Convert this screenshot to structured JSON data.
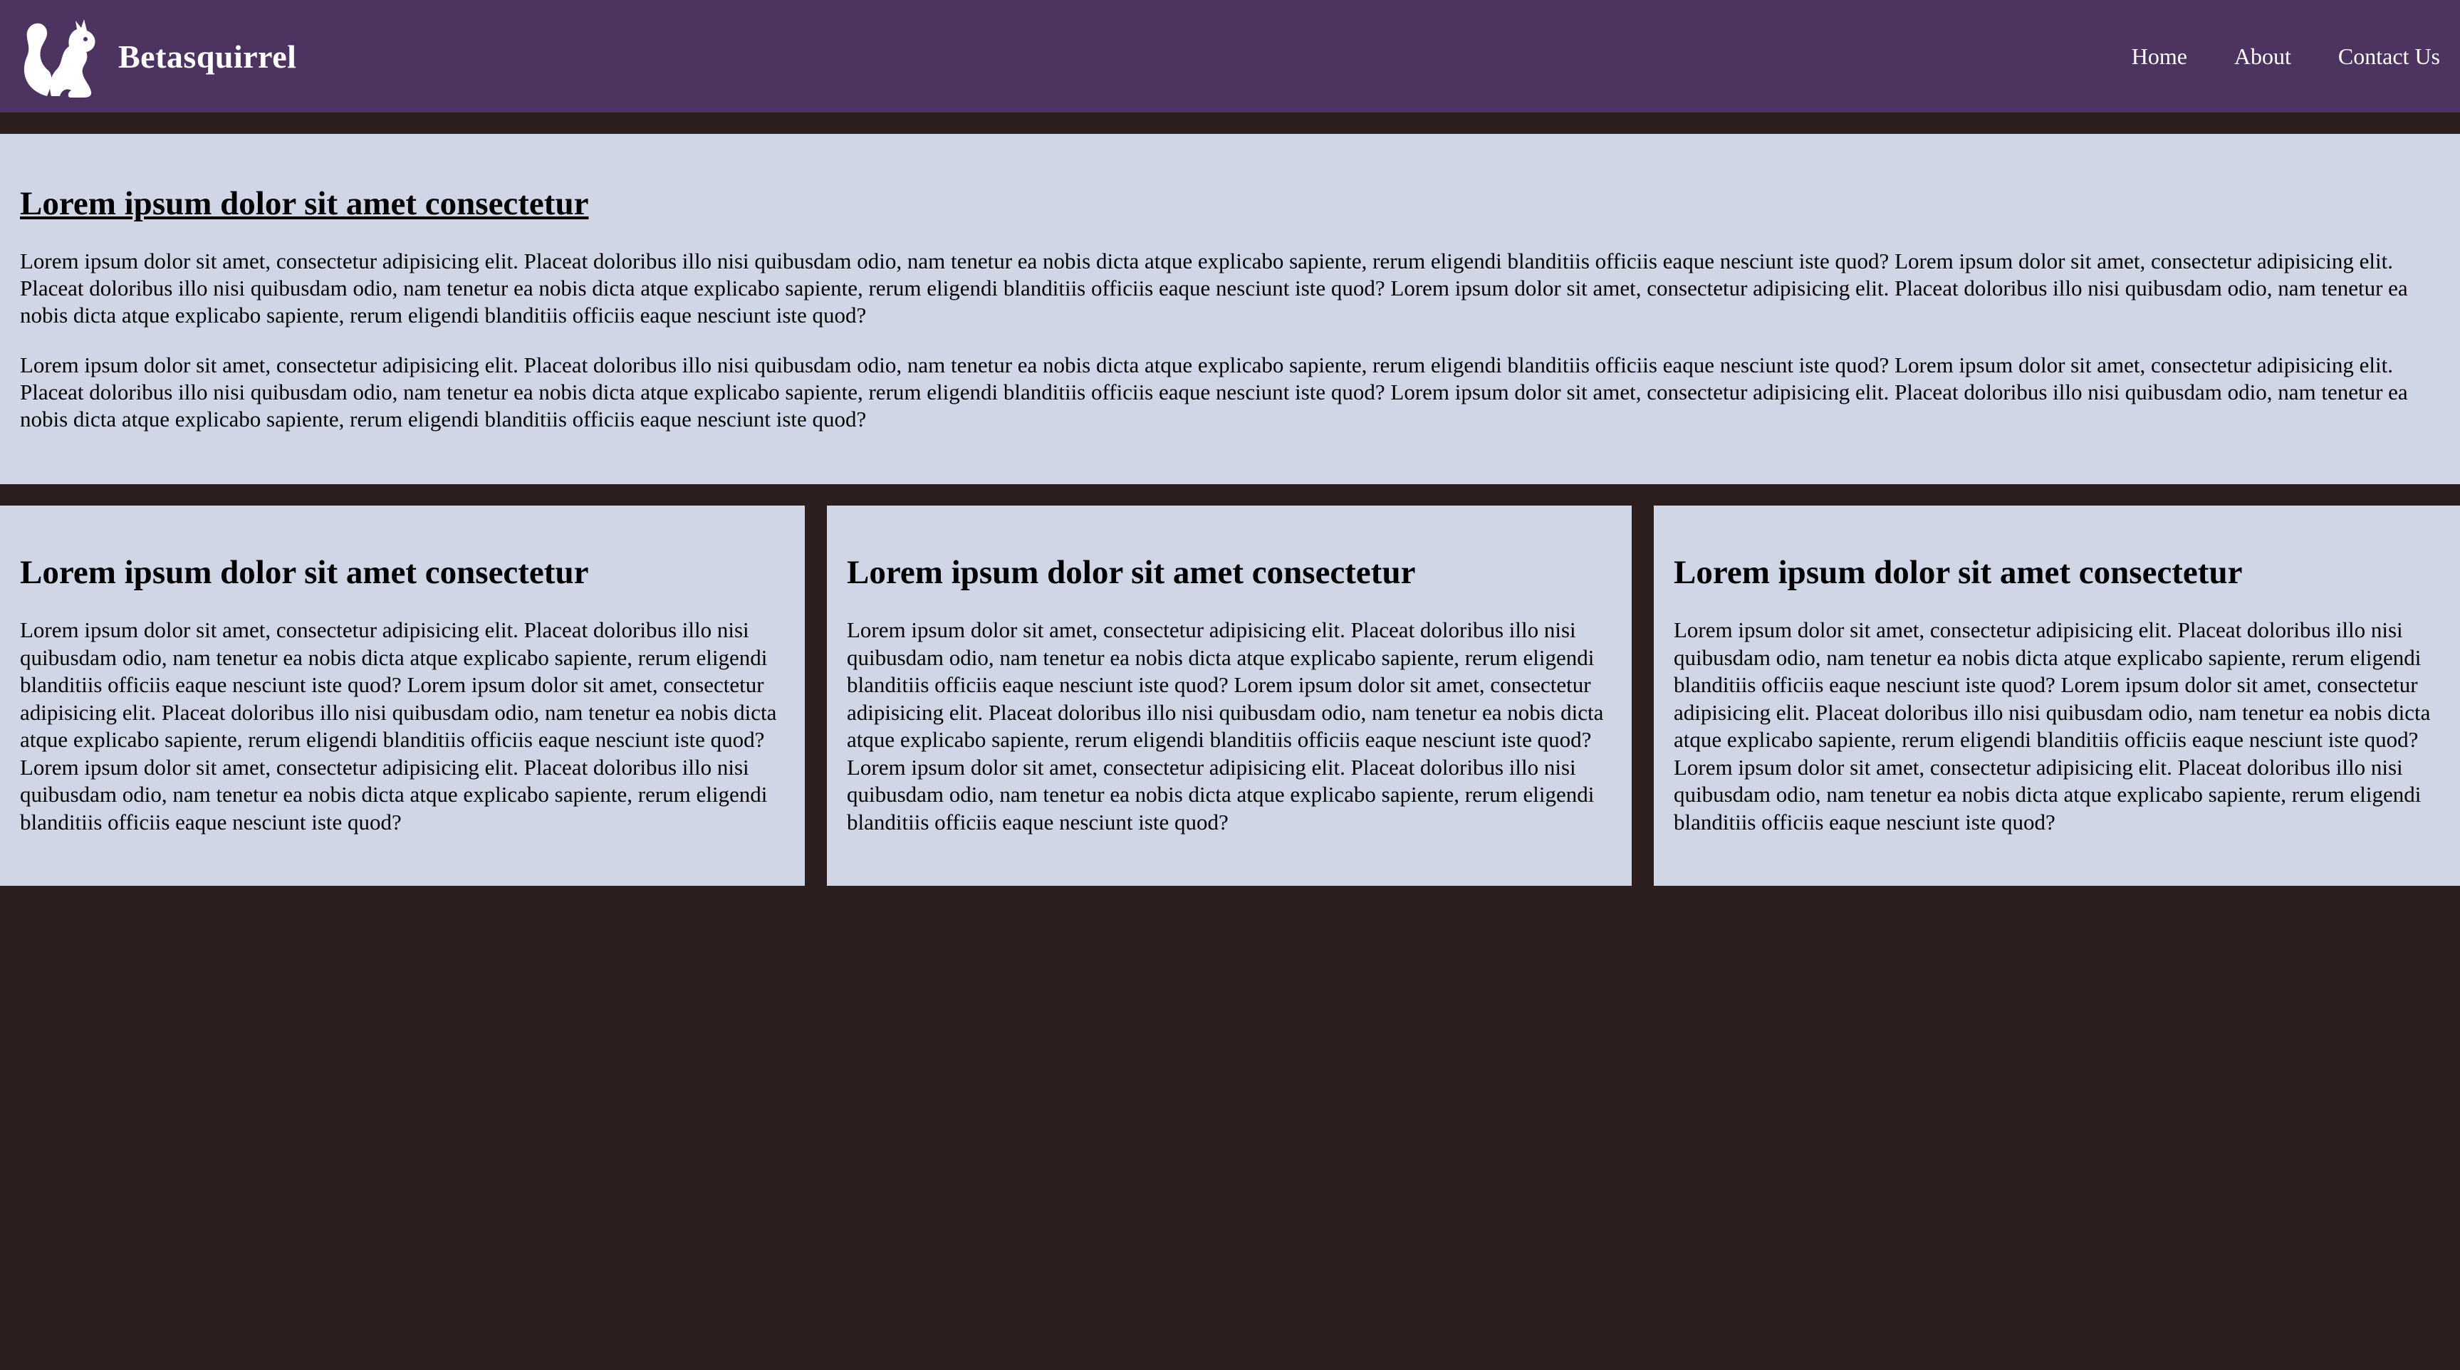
{
  "header": {
    "brand_name": "Betasquirrel",
    "logo_icon": "squirrel-icon",
    "nav": [
      {
        "label": "Home"
      },
      {
        "label": "About"
      },
      {
        "label": "Contact Us"
      }
    ]
  },
  "hero": {
    "title": "Lorem ipsum dolor sit amet consectetur",
    "paragraphs": [
      "Lorem ipsum dolor sit amet, consectetur adipisicing elit. Placeat doloribus illo nisi quibusdam odio, nam tenetur ea nobis dicta atque explicabo sapiente, rerum eligendi blanditiis officiis eaque nesciunt iste quod? Lorem ipsum dolor sit amet, consectetur adipisicing elit. Placeat doloribus illo nisi quibusdam odio, nam tenetur ea nobis dicta atque explicabo sapiente, rerum eligendi blanditiis officiis eaque nesciunt iste quod? Lorem ipsum dolor sit amet, consectetur adipisicing elit. Placeat doloribus illo nisi quibusdam odio, nam tenetur ea nobis dicta atque explicabo sapiente, rerum eligendi blanditiis officiis eaque nesciunt iste quod?",
      "Lorem ipsum dolor sit amet, consectetur adipisicing elit. Placeat doloribus illo nisi quibusdam odio, nam tenetur ea nobis dicta atque explicabo sapiente, rerum eligendi blanditiis officiis eaque nesciunt iste quod? Lorem ipsum dolor sit amet, consectetur adipisicing elit. Placeat doloribus illo nisi quibusdam odio, nam tenetur ea nobis dicta atque explicabo sapiente, rerum eligendi blanditiis officiis eaque nesciunt iste quod? Lorem ipsum dolor sit amet, consectetur adipisicing elit. Placeat doloribus illo nisi quibusdam odio, nam tenetur ea nobis dicta atque explicabo sapiente, rerum eligendi blanditiis officiis eaque nesciunt iste quod?"
    ]
  },
  "cards": [
    {
      "title": "Lorem ipsum dolor sit amet consectetur",
      "body": "Lorem ipsum dolor sit amet, consectetur adipisicing elit. Placeat doloribus illo nisi quibusdam odio, nam tenetur ea nobis dicta atque explicabo sapiente, rerum eligendi blanditiis officiis eaque nesciunt iste quod? Lorem ipsum dolor sit amet, consectetur adipisicing elit. Placeat doloribus illo nisi quibusdam odio, nam tenetur ea nobis dicta atque explicabo sapiente, rerum eligendi blanditiis officiis eaque nesciunt iste quod? Lorem ipsum dolor sit amet, consectetur adipisicing elit. Placeat doloribus illo nisi quibusdam odio, nam tenetur ea nobis dicta atque explicabo sapiente, rerum eligendi blanditiis officiis eaque nesciunt iste quod?"
    },
    {
      "title": "Lorem ipsum dolor sit amet consectetur",
      "body": "Lorem ipsum dolor sit amet, consectetur adipisicing elit. Placeat doloribus illo nisi quibusdam odio, nam tenetur ea nobis dicta atque explicabo sapiente, rerum eligendi blanditiis officiis eaque nesciunt iste quod? Lorem ipsum dolor sit amet, consectetur adipisicing elit. Placeat doloribus illo nisi quibusdam odio, nam tenetur ea nobis dicta atque explicabo sapiente, rerum eligendi blanditiis officiis eaque nesciunt iste quod? Lorem ipsum dolor sit amet, consectetur adipisicing elit. Placeat doloribus illo nisi quibusdam odio, nam tenetur ea nobis dicta atque explicabo sapiente, rerum eligendi blanditiis officiis eaque nesciunt iste quod?"
    },
    {
      "title": "Lorem ipsum dolor sit amet consectetur",
      "body": "Lorem ipsum dolor sit amet, consectetur adipisicing elit. Placeat doloribus illo nisi quibusdam odio, nam tenetur ea nobis dicta atque explicabo sapiente, rerum eligendi blanditiis officiis eaque nesciunt iste quod? Lorem ipsum dolor sit amet, consectetur adipisicing elit. Placeat doloribus illo nisi quibusdam odio, nam tenetur ea nobis dicta atque explicabo sapiente, rerum eligendi blanditiis officiis eaque nesciunt iste quod? Lorem ipsum dolor sit amet, consectetur adipisicing elit. Placeat doloribus illo nisi quibusdam odio, nam tenetur ea nobis dicta atque explicabo sapiente, rerum eligendi blanditiis officiis eaque nesciunt iste quod?"
    }
  ],
  "colors": {
    "header_bg": "#4c3360",
    "page_bg": "#2c1e1e",
    "panel_bg": "#d0d6e6"
  }
}
